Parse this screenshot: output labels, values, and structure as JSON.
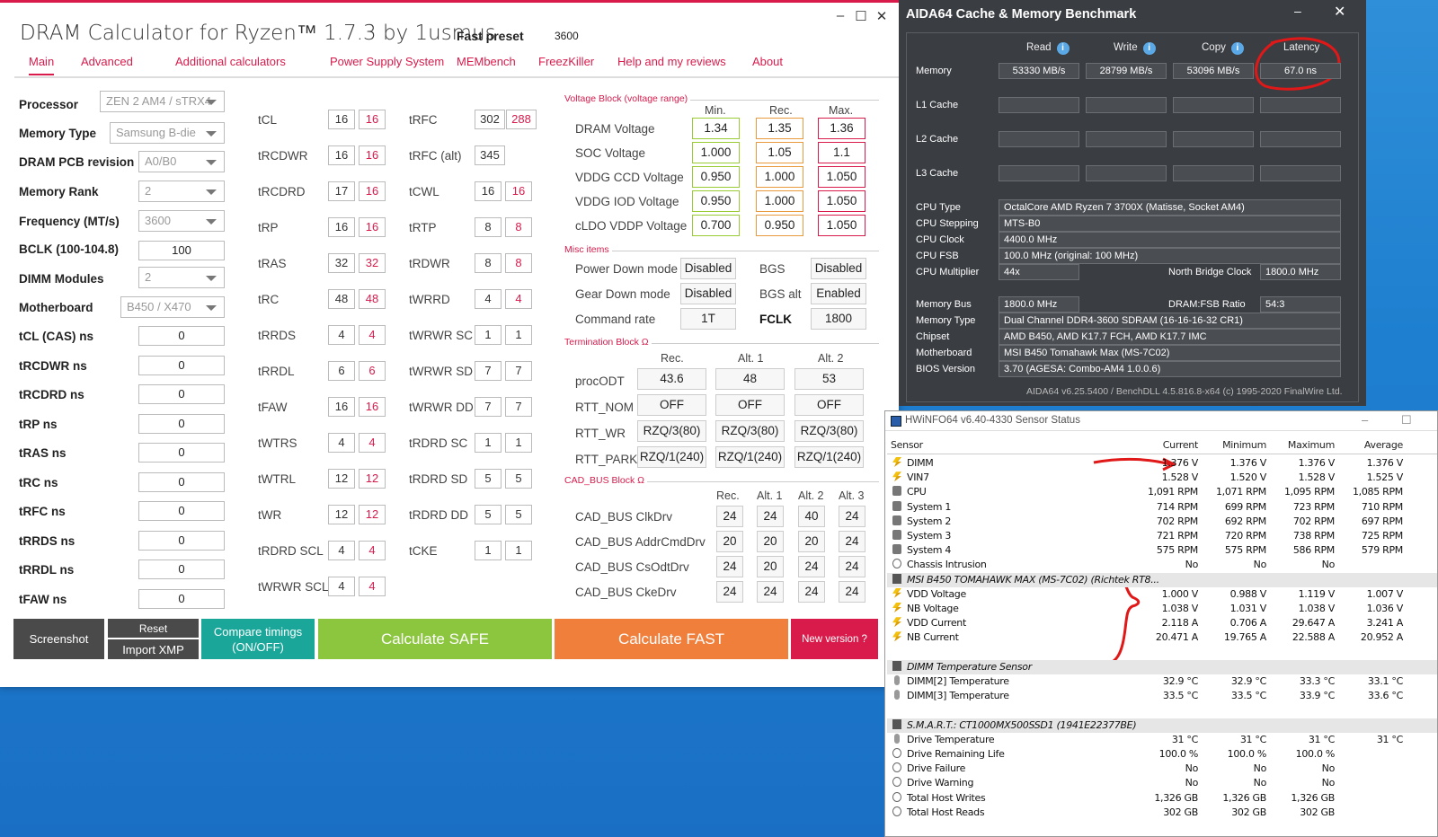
{
  "dram": {
    "title": "DRAM Calculator for Ryzen™ 1.7.3 by 1usmus",
    "preset_label": "Fast preset",
    "preset_value": "3600",
    "tabs": [
      "Main",
      "Advanced",
      "Additional calculators",
      "Power Supply System",
      "MEMbench",
      "FreezKiller",
      "Help and my reviews",
      "About"
    ],
    "left": {
      "processor": {
        "label": "Processor",
        "value": "ZEN 2 AM4 / sTRX4"
      },
      "memtype": {
        "label": "Memory Type",
        "value": "Samsung B-die"
      },
      "pcb": {
        "label": "DRAM PCB revision",
        "value": "A0/B0"
      },
      "rank": {
        "label": "Memory Rank",
        "value": "2"
      },
      "freq": {
        "label": "Frequency (MT/s)",
        "value": "3600"
      },
      "bclk": {
        "label": "BCLK (100-104.8)",
        "value": "100"
      },
      "dimm": {
        "label": "DIMM Modules",
        "value": "2"
      },
      "mobo": {
        "label": "Motherboard",
        "value": "B450 / X470"
      },
      "ns": [
        {
          "label": "tCL (CAS) ns",
          "value": "0"
        },
        {
          "label": "tRCDWR ns",
          "value": "0"
        },
        {
          "label": "tRCDRD ns",
          "value": "0"
        },
        {
          "label": "tRP ns",
          "value": "0"
        },
        {
          "label": "tRAS ns",
          "value": "0"
        },
        {
          "label": "tRC ns",
          "value": "0"
        },
        {
          "label": "tRFC ns",
          "value": "0"
        },
        {
          "label": "tRRDS ns",
          "value": "0"
        },
        {
          "label": "tRRDL ns",
          "value": "0"
        },
        {
          "label": "tFAW ns",
          "value": "0"
        }
      ]
    },
    "timings1": [
      {
        "n": "tCL",
        "a": "16",
        "b": "16"
      },
      {
        "n": "tRCDWR",
        "a": "16",
        "b": "16"
      },
      {
        "n": "tRCDRD",
        "a": "17",
        "b": "16"
      },
      {
        "n": "tRP",
        "a": "16",
        "b": "16"
      },
      {
        "n": "tRAS",
        "a": "32",
        "b": "32"
      },
      {
        "n": "tRC",
        "a": "48",
        "b": "48"
      },
      {
        "n": "tRRDS",
        "a": "4",
        "b": "4"
      },
      {
        "n": "tRRDL",
        "a": "6",
        "b": "6"
      },
      {
        "n": "tFAW",
        "a": "16",
        "b": "16"
      },
      {
        "n": "tWTRS",
        "a": "4",
        "b": "4"
      },
      {
        "n": "tWTRL",
        "a": "12",
        "b": "12"
      },
      {
        "n": "tWR",
        "a": "12",
        "b": "12"
      },
      {
        "n": "tRDRD SCL",
        "a": "4",
        "b": "4"
      },
      {
        "n": "tWRWR SCL",
        "a": "4",
        "b": "4"
      }
    ],
    "timings2": [
      {
        "n": "tRFC",
        "a": "302",
        "b": "288"
      },
      {
        "n": "tRFC (alt)",
        "a": "345",
        "b": ""
      },
      {
        "n": "tCWL",
        "a": "16",
        "b": "16"
      },
      {
        "n": "tRTP",
        "a": "8",
        "b": "8"
      },
      {
        "n": "tRDWR",
        "a": "8",
        "b": "8"
      },
      {
        "n": "tWRRD",
        "a": "4",
        "b": "4"
      },
      {
        "n": "tWRWR SC",
        "a": "1",
        "b": "1"
      },
      {
        "n": "tWRWR SD",
        "a": "7",
        "b": "7"
      },
      {
        "n": "tWRWR DD",
        "a": "7",
        "b": "7"
      },
      {
        "n": "tRDRD SC",
        "a": "1",
        "b": "1"
      },
      {
        "n": "tRDRD SD",
        "a": "5",
        "b": "5"
      },
      {
        "n": "tRDRD DD",
        "a": "5",
        "b": "5"
      },
      {
        "n": "tCKE",
        "a": "1",
        "b": "1"
      }
    ],
    "voltage": {
      "title": "Voltage Block (voltage range)",
      "headers": [
        "Min.",
        "Rec.",
        "Max."
      ],
      "rows": [
        {
          "n": "DRAM Voltage",
          "v": [
            "1.34",
            "1.35",
            "1.36"
          ]
        },
        {
          "n": "SOC Voltage",
          "v": [
            "1.000",
            "1.05",
            "1.1"
          ]
        },
        {
          "n": "VDDG  CCD Voltage",
          "v": [
            "0.950",
            "1.000",
            "1.050"
          ]
        },
        {
          "n": "VDDG  IOD Voltage",
          "v": [
            "0.950",
            "1.000",
            "1.050"
          ]
        },
        {
          "n": "cLDO VDDP Voltage",
          "v": [
            "0.700",
            "0.950",
            "1.050"
          ]
        }
      ]
    },
    "misc": {
      "title": "Misc items",
      "pd": "Power Down mode",
      "pd_v": "Disabled",
      "gd": "Gear Down mode",
      "gd_v": "Disabled",
      "cr": "Command rate",
      "cr_v": "1T",
      "bgs": "BGS",
      "bgs_v": "Disabled",
      "bgsalt": "BGS alt",
      "bgsalt_v": "Enabled",
      "fclk": "FCLK",
      "fclk_v": "1800"
    },
    "term": {
      "title": "Termination Block Ω",
      "headers": [
        "Rec.",
        "Alt. 1",
        "Alt. 2"
      ],
      "rows": [
        {
          "n": "procODT",
          "v": [
            "43.6",
            "48",
            "53"
          ]
        },
        {
          "n": "RTT_NOM",
          "v": [
            "OFF",
            "OFF",
            "OFF"
          ]
        },
        {
          "n": "RTT_WR",
          "v": [
            "RZQ/3(80)",
            "RZQ/3(80)",
            "RZQ/3(80)"
          ]
        },
        {
          "n": "RTT_PARK",
          "v": [
            "RZQ/1(240)",
            "RZQ/1(240)",
            "RZQ/1(240)"
          ]
        }
      ]
    },
    "cad": {
      "title": "CAD_BUS Block Ω",
      "headers": [
        "Rec.",
        "Alt. 1",
        "Alt. 2",
        "Alt. 3"
      ],
      "rows": [
        {
          "n": "CAD_BUS ClkDrv",
          "v": [
            "24",
            "24",
            "40",
            "24"
          ]
        },
        {
          "n": "CAD_BUS AddrCmdDrv",
          "v": [
            "20",
            "20",
            "20",
            "24"
          ]
        },
        {
          "n": "CAD_BUS CsOdtDrv",
          "v": [
            "24",
            "20",
            "24",
            "24"
          ]
        },
        {
          "n": "CAD_BUS CkeDrv",
          "v": [
            "24",
            "24",
            "24",
            "24"
          ]
        }
      ]
    },
    "buttons": {
      "screenshot": "Screenshot",
      "reset": "Reset",
      "import": "Import XMP",
      "compare": "Compare timings (ON/OFF)",
      "safe": "Calculate SAFE",
      "fast": "Calculate FAST",
      "newver": "New version ?"
    },
    "colors": {
      "accent": "#d81b4b",
      "safe": "#8cc63f",
      "fast": "#f07f3c",
      "compare": "#1aa79a",
      "dark": "#4a4a4a"
    }
  },
  "aida": {
    "title": "AIDA64 Cache & Memory Benchmark",
    "headers": [
      "Read",
      "Write",
      "Copy",
      "Latency"
    ],
    "rows": [
      {
        "n": "Memory",
        "v": [
          "53330 MB/s",
          "28799 MB/s",
          "53096 MB/s",
          "67.0 ns"
        ]
      },
      {
        "n": "L1 Cache",
        "v": [
          "",
          "",
          "",
          ""
        ]
      },
      {
        "n": "L2 Cache",
        "v": [
          "",
          "",
          "",
          ""
        ]
      },
      {
        "n": "L3 Cache",
        "v": [
          "",
          "",
          "",
          ""
        ]
      }
    ],
    "info": [
      {
        "n": "CPU Type",
        "v": "OctalCore AMD Ryzen 7 3700X  (Matisse, Socket AM4)"
      },
      {
        "n": "CPU Stepping",
        "v": "MTS-B0"
      },
      {
        "n": "CPU Clock",
        "v": "4400.0 MHz"
      },
      {
        "n": "CPU FSB",
        "v": "100.0 MHz  (original: 100 MHz)"
      }
    ],
    "mult": {
      "n": "CPU Multiplier",
      "v": "44x",
      "nb": "North Bridge Clock",
      "nb_v": "1800.0 MHz"
    },
    "bus": {
      "n": "Memory Bus",
      "v": "1800.0 MHz",
      "r": "DRAM:FSB Ratio",
      "r_v": "54:3"
    },
    "info2": [
      {
        "n": "Memory Type",
        "v": "Dual Channel DDR4-3600 SDRAM  (16-16-16-32 CR1)"
      },
      {
        "n": "Chipset",
        "v": "AMD B450, AMD K17.7 FCH, AMD K17.7 IMC"
      },
      {
        "n": "Motherboard",
        "v": "MSI B450 Tomahawk Max (MS-7C02)"
      },
      {
        "n": "BIOS Version",
        "v": "3.70  (AGESA: Combo-AM4 1.0.0.6)"
      }
    ],
    "footer": "AIDA64 v6.25.5400 / BenchDLL 4.5.816.8-x64  (c) 1995-2020 FinalWire Ltd."
  },
  "hw": {
    "title": "HWiNFO64 v6.40-4330 Sensor Status",
    "cols": [
      "Sensor",
      "Current",
      "Minimum",
      "Maximum",
      "Average"
    ],
    "rows": [
      {
        "t": "v",
        "n": "DIMM",
        "v": [
          "1.376 V",
          "1.376 V",
          "1.376 V",
          "1.376 V"
        ]
      },
      {
        "t": "v",
        "n": "VIN7",
        "v": [
          "1.528 V",
          "1.520 V",
          "1.528 V",
          "1.525 V"
        ]
      },
      {
        "t": "f",
        "n": "CPU",
        "v": [
          "1,091 RPM",
          "1,071 RPM",
          "1,095 RPM",
          "1,085 RPM"
        ]
      },
      {
        "t": "f",
        "n": "System 1",
        "v": [
          "714 RPM",
          "699 RPM",
          "723 RPM",
          "710 RPM"
        ]
      },
      {
        "t": "f",
        "n": "System 2",
        "v": [
          "702 RPM",
          "692 RPM",
          "702 RPM",
          "697 RPM"
        ]
      },
      {
        "t": "f",
        "n": "System 3",
        "v": [
          "721 RPM",
          "720 RPM",
          "738 RPM",
          "725 RPM"
        ]
      },
      {
        "t": "f",
        "n": "System 4",
        "v": [
          "575 RPM",
          "575 RPM",
          "586 RPM",
          "579 RPM"
        ]
      },
      {
        "t": "o",
        "n": "Chassis Intrusion",
        "v": [
          "No",
          "No",
          "No",
          ""
        ]
      },
      {
        "t": "g",
        "n": "MSI B450 TOMAHAWK MAX (MS-7C02) (Richtek RT8...",
        "v": [
          "",
          "",
          "",
          ""
        ]
      },
      {
        "t": "v",
        "n": "VDD Voltage",
        "v": [
          "1.000 V",
          "0.988 V",
          "1.119 V",
          "1.007 V"
        ]
      },
      {
        "t": "v",
        "n": "NB Voltage",
        "v": [
          "1.038 V",
          "1.031 V",
          "1.038 V",
          "1.036 V"
        ]
      },
      {
        "t": "v",
        "n": "VDD Current",
        "v": [
          "2.118 A",
          "0.706 A",
          "29.647 A",
          "3.241 A"
        ]
      },
      {
        "t": "v",
        "n": "NB Current",
        "v": [
          "20.471 A",
          "19.765 A",
          "22.588 A",
          "20.952 A"
        ]
      },
      {
        "t": "e",
        "n": "",
        "v": [
          "",
          "",
          "",
          ""
        ]
      },
      {
        "t": "g",
        "n": "DIMM Temperature Sensor",
        "v": [
          "",
          "",
          "",
          ""
        ]
      },
      {
        "t": "t",
        "n": "DIMM[2] Temperature",
        "v": [
          "32.9 °C",
          "32.9 °C",
          "33.3 °C",
          "33.1 °C"
        ]
      },
      {
        "t": "t",
        "n": "DIMM[3] Temperature",
        "v": [
          "33.5 °C",
          "33.5 °C",
          "33.9 °C",
          "33.6 °C"
        ]
      },
      {
        "t": "e",
        "n": "",
        "v": [
          "",
          "",
          "",
          ""
        ]
      },
      {
        "t": "g",
        "n": "S.M.A.R.T.: CT1000MX500SSD1 (1941E22377BE)",
        "v": [
          "",
          "",
          "",
          ""
        ]
      },
      {
        "t": "t",
        "n": "Drive Temperature",
        "v": [
          "31 °C",
          "31 °C",
          "31 °C",
          "31 °C"
        ]
      },
      {
        "t": "o",
        "n": "Drive Remaining Life",
        "v": [
          "100.0 %",
          "100.0 %",
          "100.0 %",
          ""
        ]
      },
      {
        "t": "o",
        "n": "Drive Failure",
        "v": [
          "No",
          "No",
          "No",
          ""
        ]
      },
      {
        "t": "o",
        "n": "Drive Warning",
        "v": [
          "No",
          "No",
          "No",
          ""
        ]
      },
      {
        "t": "o",
        "n": "Total Host Writes",
        "v": [
          "1,326 GB",
          "1,326 GB",
          "1,326 GB",
          ""
        ]
      },
      {
        "t": "o",
        "n": "Total Host Reads",
        "v": [
          "302 GB",
          "302 GB",
          "302 GB",
          ""
        ]
      }
    ]
  }
}
